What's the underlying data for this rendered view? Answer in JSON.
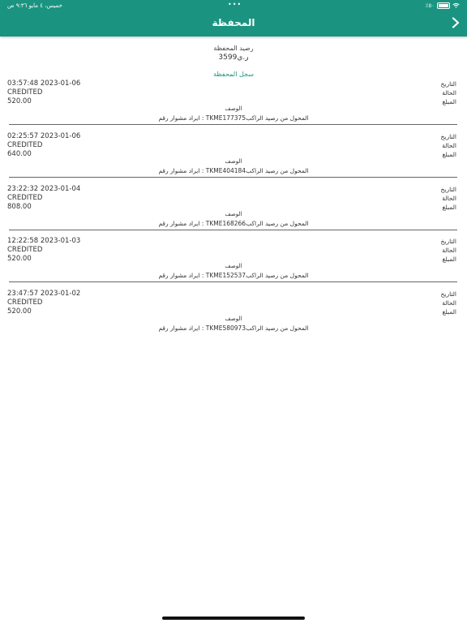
{
  "status": {
    "time": "٩:٣٦ ص",
    "date": "خميس، ٤ مايو",
    "battery": "٪٥٠"
  },
  "header": {
    "title": "المحفظة"
  },
  "balance": {
    "label": "رصيد المحفظة",
    "value": "ر.ي3599"
  },
  "history": {
    "title": "سجل المحفظة"
  },
  "labels": {
    "date": "التاريخ",
    "status": "الحالة",
    "amount": "المبلغ",
    "description": "الوصف"
  },
  "transactions": [
    {
      "datetime": "03:57:48 2023-01-06",
      "status": "CREDITED",
      "amount": "520.00",
      "description": "ايراد مشوار رقم  :  TKME177375المحول من رصيد الراكب"
    },
    {
      "datetime": "02:25:57 2023-01-06",
      "status": "CREDITED",
      "amount": "640.00",
      "description": "ايراد مشوار رقم  :  TKME404184المحول من رصيد الراكب"
    },
    {
      "datetime": "23:22:32 2023-01-04",
      "status": "CREDITED",
      "amount": "808.00",
      "description": "ايراد مشوار رقم  :  TKME168266المحول من رصيد الراكب"
    },
    {
      "datetime": "12:22:58 2023-01-03",
      "status": "CREDITED",
      "amount": "520.00",
      "description": "ايراد مشوار رقم  :  TKME152537المحول من رصيد الراكب"
    },
    {
      "datetime": "23:47:57 2023-01-02",
      "status": "CREDITED",
      "amount": "520.00",
      "description": "ايراد مشوار رقم  :  TKME580973المحول من رصيد الراكب"
    }
  ]
}
